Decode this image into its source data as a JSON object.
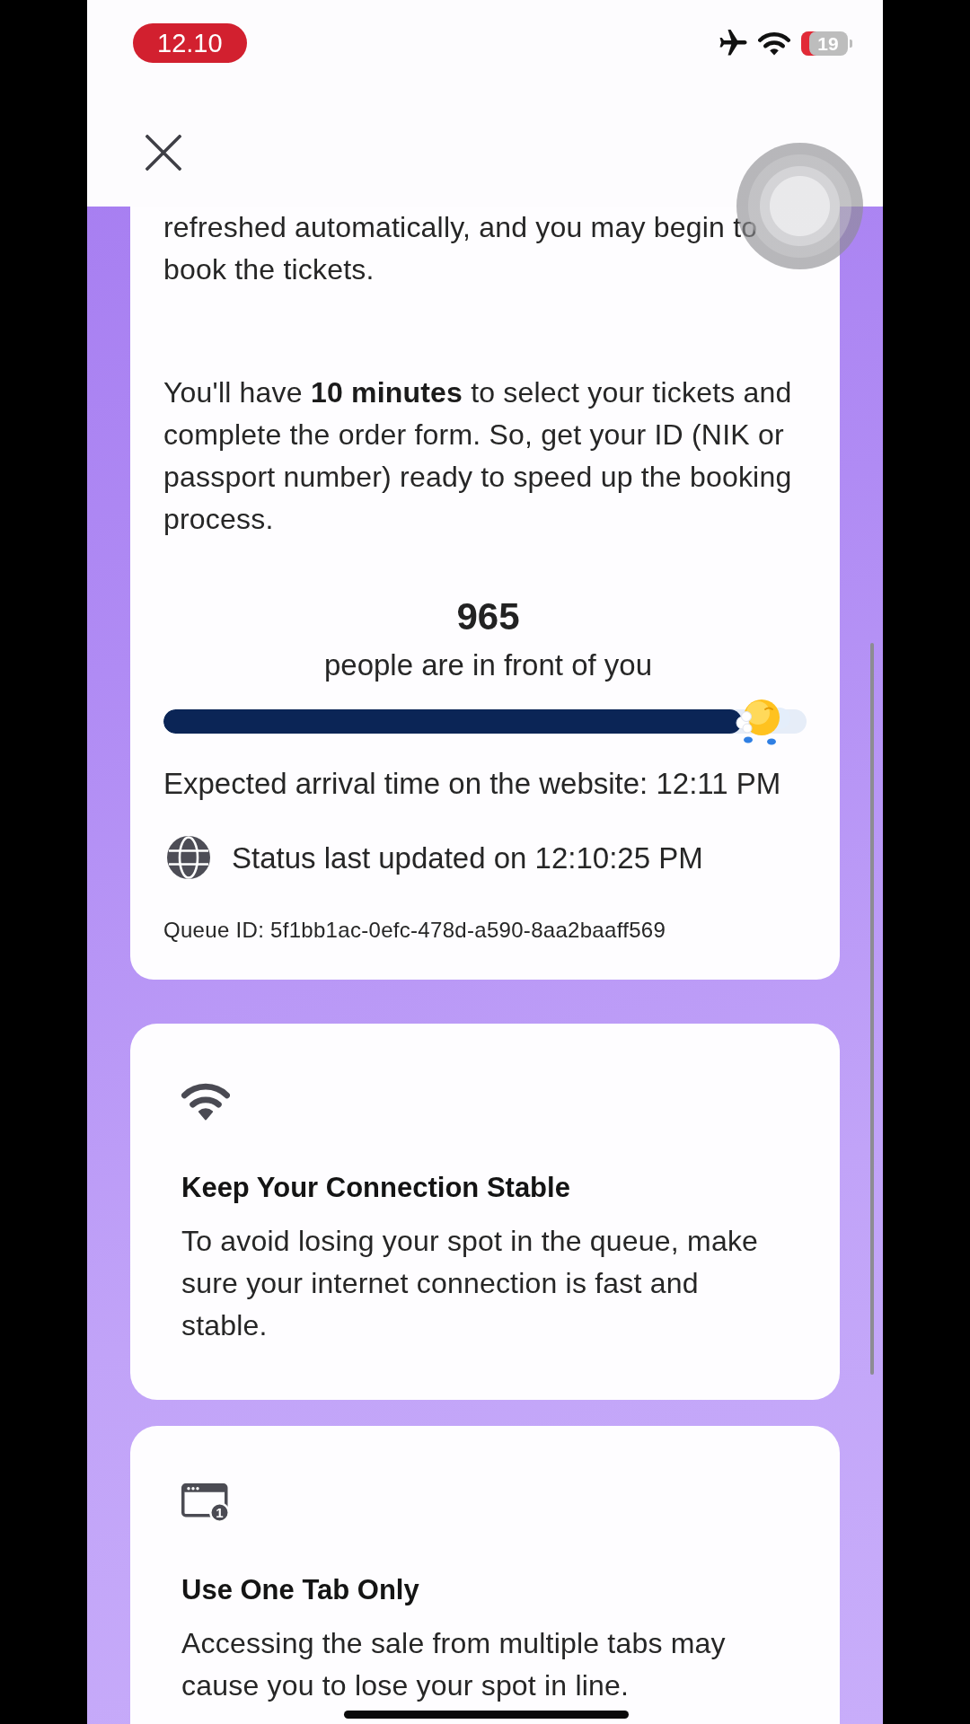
{
  "status_bar": {
    "time": "12.10",
    "battery": "19"
  },
  "queue_card": {
    "paragraphs": [
      "refreshed automatically, and you may begin to book the tickets.",
      "You'll have **10 minutes** to select your tickets and complete the order form. So, get your ID (NIK or passport number) ready to speed up the booking process."
    ],
    "count": "965",
    "count_caption": "people are in front of you",
    "progress": {
      "level": 0.9
    },
    "expected_arrival": "Expected arrival time on the website: 12:11 PM",
    "status_updated": "Status last updated on 12:10:25 PM",
    "queue_id": "Queue ID: 5f1bb1ac-0efc-478d-a590-8aa2baaff569"
  },
  "tips": [
    {
      "kind": "connection",
      "title": "Keep Your Connection Stable",
      "body": "To avoid losing your spot in the queue, make sure your internet connection is fast and stable."
    },
    {
      "kind": "tab",
      "icon_badge": "1",
      "title": "Use One Tab Only",
      "body": "Accessing the sale from multiple tabs may cause you to lose your spot in line."
    }
  ]
}
